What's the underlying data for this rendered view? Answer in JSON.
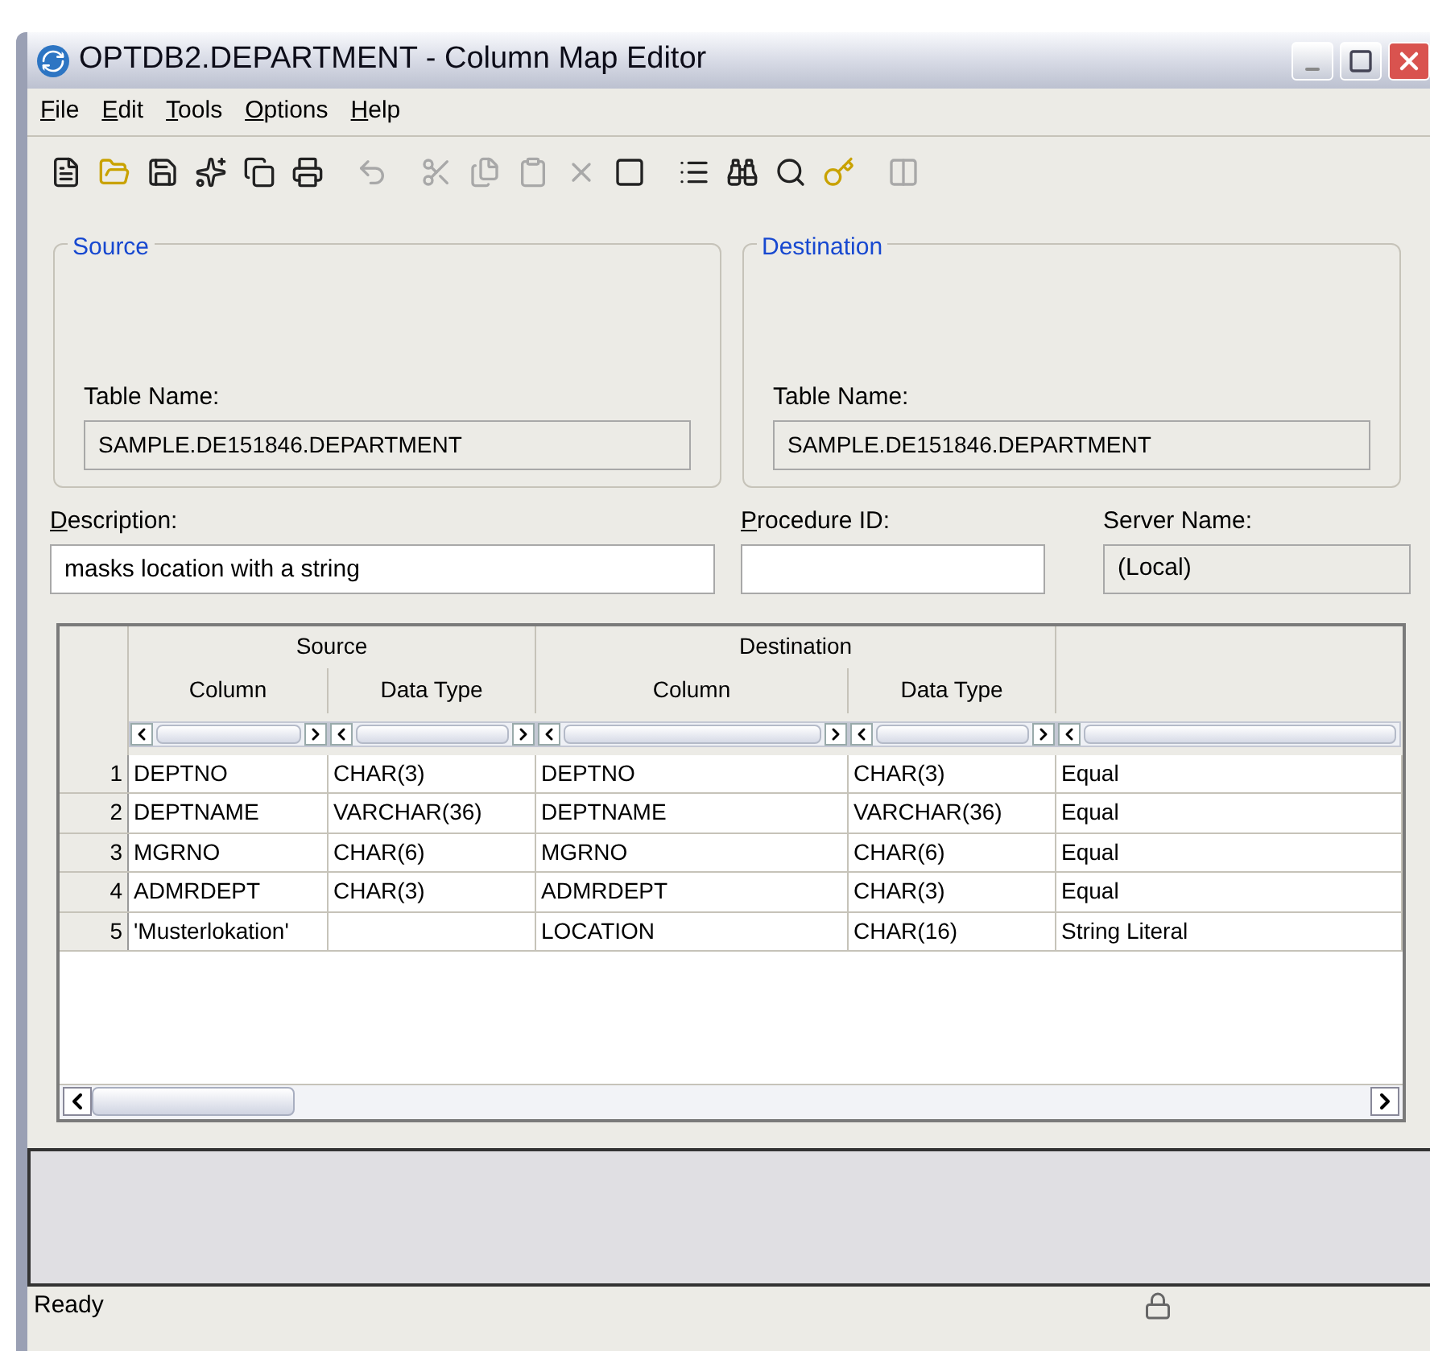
{
  "window": {
    "title": "OPTDB2.DEPARTMENT - Column Map Editor"
  },
  "menu": [
    "File",
    "Edit",
    "Tools",
    "Options",
    "Help"
  ],
  "toolbar": [
    {
      "disabled": false
    },
    {
      "disabled": false
    },
    {
      "disabled": false
    },
    {
      "disabled": false
    },
    {
      "disabled": false
    },
    {
      "disabled": false
    },
    {
      "disabled": true
    },
    {
      "disabled": true
    },
    {
      "disabled": true
    },
    {
      "disabled": true
    },
    {
      "disabled": true
    },
    {
      "disabled": false
    },
    {
      "disabled": false
    },
    {
      "disabled": false
    },
    {
      "disabled": false
    },
    {
      "disabled": false
    },
    {
      "disabled": true
    }
  ],
  "source": {
    "title": "Source",
    "label": "Table Name:",
    "value": "SAMPLE.DE151846.DEPARTMENT"
  },
  "destination": {
    "title": "Destination",
    "label": "Table Name:",
    "value": "SAMPLE.DE151846.DEPARTMENT"
  },
  "description": {
    "label": "Description:",
    "value": "masks location with a string"
  },
  "procedure_id": {
    "label": "Procedure ID:"
  },
  "server_name": {
    "label": "Server Name:",
    "value": "(Local)"
  },
  "table": {
    "groups": [
      "Source",
      "Destination"
    ],
    "columns": [
      "Column",
      "Data Type",
      "Column",
      "Data Type"
    ],
    "rows": [
      {
        "number": "1",
        "cells": [
          "DEPTNO",
          "CHAR(3)",
          "DEPTNO",
          "CHAR(3)",
          "Equal"
        ]
      },
      {
        "number": "2",
        "cells": [
          "DEPTNAME",
          "VARCHAR(36)",
          "DEPTNAME",
          "VARCHAR(36)",
          "Equal"
        ]
      },
      {
        "number": "3",
        "cells": [
          "MGRNO",
          "CHAR(6)",
          "MGRNO",
          "CHAR(6)",
          "Equal"
        ]
      },
      {
        "number": "4",
        "cells": [
          "ADMRDEPT",
          "CHAR(3)",
          "ADMRDEPT",
          "CHAR(3)",
          "Equal"
        ]
      },
      {
        "number": "5",
        "cells": [
          "'Musterlokation'",
          "",
          "LOCATION",
          "CHAR(16)",
          "String Literal"
        ]
      }
    ]
  },
  "status_bar": {
    "text": "Ready"
  }
}
